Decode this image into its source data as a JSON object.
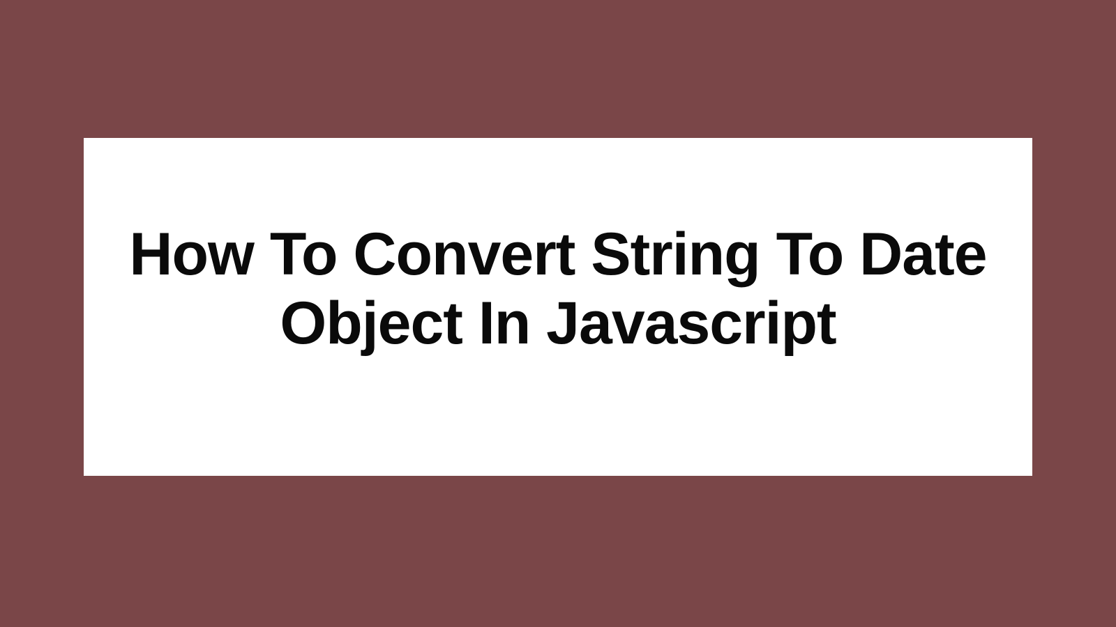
{
  "card": {
    "title": "How To Convert String To Date Object In Javascript"
  }
}
